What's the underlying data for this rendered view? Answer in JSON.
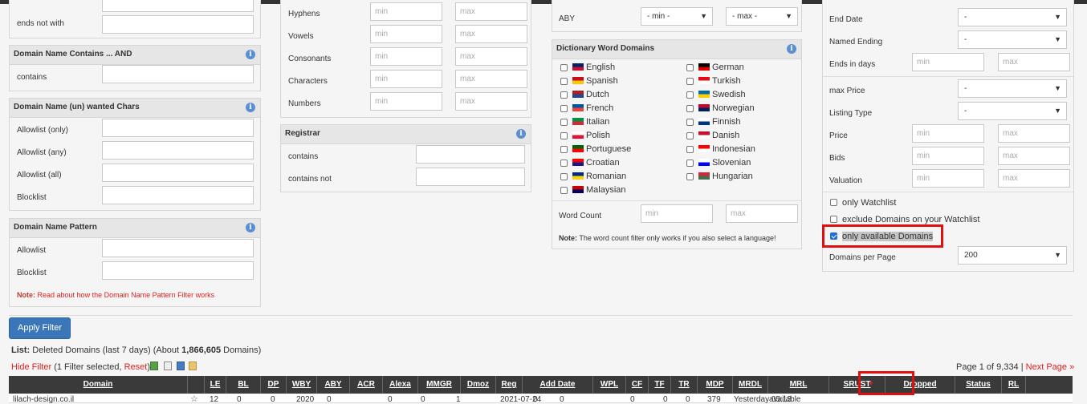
{
  "colors": {
    "accent_blue": "#3b77b8",
    "highlight_red": "#e01010",
    "header_dark": "#3a3a3a",
    "link_red": "#e0201f"
  },
  "left": {
    "ends_not_with_label": "ends not with",
    "contains_and": {
      "title": "Domain Name Contains ... AND",
      "contains_label": "contains"
    },
    "wanted_chars": {
      "title": "Domain Name (un) wanted Chars",
      "allow_only": "Allowlist (only)",
      "allow_any": "Allowlist (any)",
      "allow_all": "Allowlist (all)",
      "blocklist": "Blocklist"
    },
    "pattern": {
      "title": "Domain Name Pattern",
      "allowlist": "Allowlist",
      "blocklist": "Blocklist",
      "note_prefix": "Note:",
      "note_text": "Read about how the Domain Name Pattern Filter works"
    }
  },
  "mid": {
    "rows": [
      {
        "label": "Hyphens",
        "min": "min",
        "max": "max"
      },
      {
        "label": "Vowels",
        "min": "min",
        "max": "max"
      },
      {
        "label": "Consonants",
        "min": "min",
        "max": "max"
      },
      {
        "label": "Characters",
        "min": "min",
        "max": "max"
      },
      {
        "label": "Numbers",
        "min": "min",
        "max": "max"
      }
    ],
    "registrar": {
      "title": "Registrar",
      "contains": "contains",
      "contains_not": "contains not"
    }
  },
  "dict": {
    "aby_label": "ABY",
    "aby_min": "- min -",
    "aby_max": "- max -",
    "title": "Dictionary Word Domains",
    "languages": [
      "English",
      "German",
      "Spanish",
      "Turkish",
      "Dutch",
      "Swedish",
      "French",
      "Norwegian",
      "Italian",
      "Finnish",
      "Polish",
      "Danish",
      "Portuguese",
      "Indonesian",
      "Croatian",
      "Slovenian",
      "Romanian",
      "Hungarian",
      "Malaysian"
    ],
    "word_count_label": "Word Count",
    "wc_min": "min",
    "wc_max": "max",
    "note_prefix": "Note:",
    "note_text": "The word count filter only works if you also select a language!"
  },
  "right": {
    "end_date": "End Date",
    "named_ending": "Named Ending",
    "ends_in_days": "Ends in days",
    "max_price": "max Price",
    "listing_type": "Listing Type",
    "price": "Price",
    "bids": "Bids",
    "valuation": "Valuation",
    "dash": "-",
    "min": "min",
    "max": "max",
    "only_watchlist": "only Watchlist",
    "exclude_watchlist": "exclude Domains on your Watchlist",
    "only_available": "only available Domains",
    "per_page_label": "Domains per Page",
    "per_page_value": "200"
  },
  "apply_filter": "Apply Filter",
  "list": {
    "prefix": "List:",
    "name": "Deleted Domains (last 7 days) (About",
    "count": "1,866,605",
    "suffix": "Domains)"
  },
  "filter_bar": {
    "hide": "Hide Filter",
    "selected": "(1 Filter selected,",
    "reset": "Reset",
    "close": ")"
  },
  "pagination": {
    "text": "Page 1 of 9,334 |",
    "next": "Next Page »"
  },
  "table": {
    "headers": [
      "Domain",
      "",
      "LE",
      "BL",
      "DP",
      "WBY",
      "ABY",
      "ACR",
      "Alexa",
      "MMGR",
      "Dmoz",
      "Reg",
      "Add Date",
      "WPL",
      "CF",
      "TF",
      "TR",
      "MDP",
      "MRDL",
      "MRL",
      "SRUST",
      "Dropped",
      "Status",
      "RL"
    ],
    "row": [
      "lilach-design.co.il",
      "12",
      "0",
      "0",
      "2020",
      "0",
      "0",
      "0",
      "1",
      "2021-07-24",
      "0",
      "0",
      "0",
      "0",
      "0",
      "379",
      "Yesterday 05:13",
      "available"
    ]
  }
}
